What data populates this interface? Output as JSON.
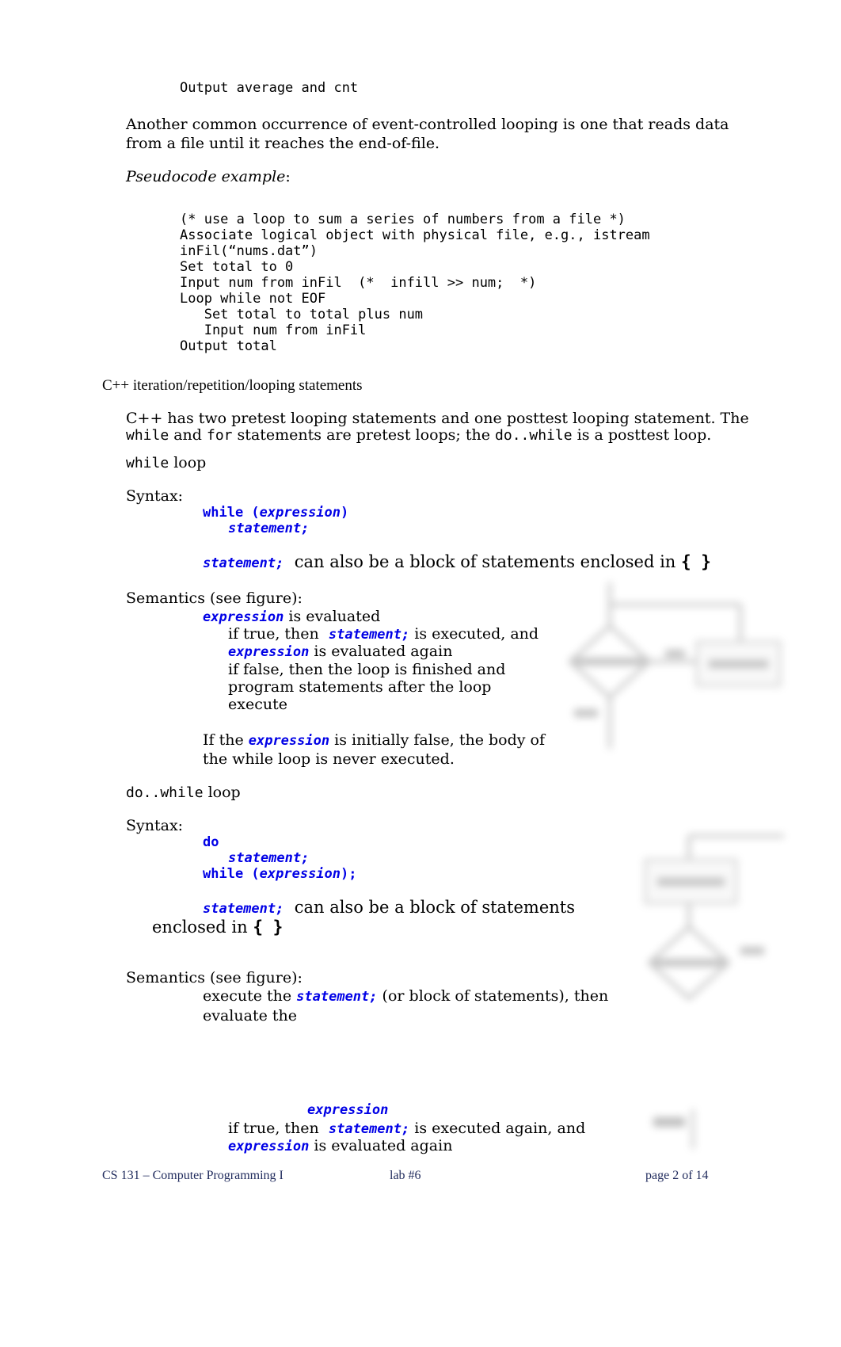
{
  "top_pseudocode_tail": "Output average and cnt",
  "eof_paragraph": {
    "line1": "Another common occurrence of event-controlled looping is one that reads data",
    "line2": "from a file until it reaches the end-of-file."
  },
  "pseudocode_label": "Pseudocode example",
  "pseudocode_colon": ":",
  "pseudocode_lines": [
    "(* use a loop to sum a series of numbers from a file *)",
    "Associate logical object with physical file, e.g., istream",
    "inFil(“nums.dat”)",
    "Set total to 0",
    "Input num from inFil  (*  infill >> num;  *)",
    "Loop while not EOF",
    "   Set total to total plus num",
    "   Input num from inFil",
    "Output total"
  ],
  "section_heading": "C++ iteration/repetition/looping statements",
  "intro": {
    "line1": "C++ has two pretest looping statements and one posttest looping statement. The",
    "l2_while": "while",
    "l2_and": " and ",
    "l2_for": "for",
    "l2_mid": " statements are pretest loops; the ",
    "l2_dowhile": "do..while",
    "l2_end": " is a posttest loop."
  },
  "while_section": {
    "title_code": "while",
    "title_text": " loop",
    "syntax_label": "Syntax:",
    "syntax_kw": "while (",
    "syntax_expr": "expression",
    "syntax_close": ")",
    "syntax_stmt": "statement;",
    "block_kw": "statement;",
    "block_text": "  can also be a block of statements enclosed in ",
    "braces": "{ }",
    "semantics_label": "Semantics (see figure):",
    "sem_expr1": "expression",
    "sem_l1": " is evaluated",
    "sem_l2a": "if true, then  ",
    "sem_l2kw": "statement;",
    "sem_l2b": " is executed, and",
    "sem_expr2": "expression",
    "sem_l3": " is evaluated again",
    "sem_l4": "if false, then the loop is finished and",
    "sem_l5": "program statements after the loop",
    "sem_l6": "execute",
    "note_a": "If the ",
    "note_kw": "expression",
    "note_b": " is initially false, the body of",
    "note_c": "the while loop is never executed."
  },
  "dowhile_section": {
    "title_code": "do..while",
    "title_text": " loop",
    "syntax_label": "Syntax:",
    "syntax_do": "do",
    "syntax_stmt": "statement;",
    "syntax_while": "while (",
    "syntax_expr": "expression",
    "syntax_close": ");",
    "block_kw": "statement;",
    "block_text": "  can also be a block of statements",
    "block_text2": "enclosed in ",
    "braces": "{ }",
    "semantics_label": "Semantics (see figure):",
    "sem_l1a": "execute the ",
    "sem_l1kw": "statement;",
    "sem_l1b": " (or block of statements), then",
    "sem_l2": "evaluate the",
    "sem_expr": "expression",
    "sem_l3a": "if true, then  ",
    "sem_l3kw": "statement;",
    "sem_l3b": " is executed again, and",
    "sem_expr2": "expression",
    "sem_l4": " is evaluated again"
  },
  "footer": {
    "course": "CS 131 – Computer Programming I",
    "lab": "lab #6",
    "page": "page 2 of 14"
  }
}
